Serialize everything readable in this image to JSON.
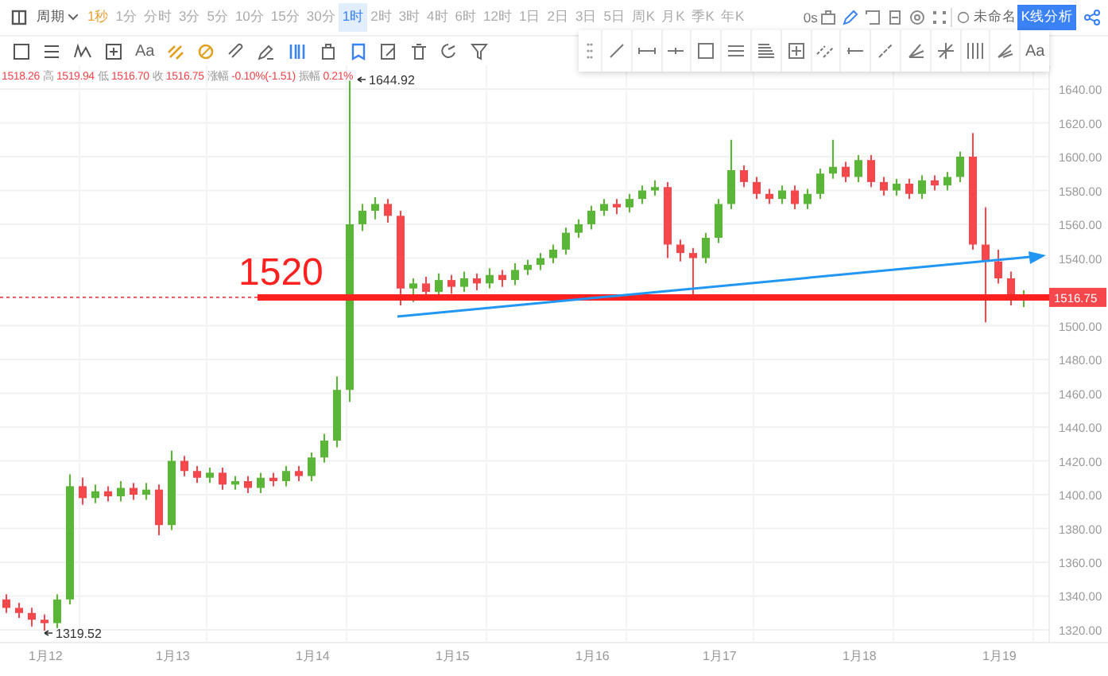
{
  "toolbar": {
    "period_label": "周期",
    "intervals": [
      {
        "label": "1秒",
        "selected": false,
        "accent": true
      },
      {
        "label": "1分",
        "selected": false,
        "accent": false
      },
      {
        "label": "分时",
        "selected": false,
        "accent": false
      },
      {
        "label": "3分",
        "selected": false,
        "accent": false
      },
      {
        "label": "5分",
        "selected": false,
        "accent": false
      },
      {
        "label": "10分",
        "selected": false,
        "accent": false
      },
      {
        "label": "15分",
        "selected": false,
        "accent": false
      },
      {
        "label": "30分",
        "selected": false,
        "accent": false
      },
      {
        "label": "1时",
        "selected": true,
        "accent": false
      },
      {
        "label": "2时",
        "selected": false,
        "accent": false
      },
      {
        "label": "3时",
        "selected": false,
        "accent": false
      },
      {
        "label": "4时",
        "selected": false,
        "accent": false
      },
      {
        "label": "6时",
        "selected": false,
        "accent": false
      },
      {
        "label": "12时",
        "selected": false,
        "accent": false
      },
      {
        "label": "1日",
        "selected": false,
        "accent": false
      },
      {
        "label": "2日",
        "selected": false,
        "accent": false
      },
      {
        "label": "3日",
        "selected": false,
        "accent": false
      },
      {
        "label": "5日",
        "selected": false,
        "accent": false
      },
      {
        "label": "周K",
        "selected": false,
        "accent": false
      },
      {
        "label": "月K",
        "selected": false,
        "accent": false
      },
      {
        "label": "季K",
        "selected": false,
        "accent": false
      },
      {
        "label": "年K",
        "selected": false,
        "accent": false
      }
    ],
    "refresh": "0s",
    "layout_name": "未命名",
    "analysis_button": "K线分析"
  },
  "drawing_tools": {
    "text_tool": "Aa"
  },
  "floating_toolbar": {
    "text_tool": "Aa"
  },
  "quote": {
    "first_value": "1518.26",
    "items": [
      {
        "label": "高",
        "value": "1519.94"
      },
      {
        "label": "低",
        "value": "1516.70"
      },
      {
        "label": "收",
        "value": "1516.75"
      },
      {
        "label": "涨幅",
        "value": "-0.10%(-1.51)"
      },
      {
        "label": "振幅",
        "value": "0.21%"
      }
    ]
  },
  "chart": {
    "high_marker": "1644.92",
    "last_price": "1516.75",
    "low_marker": "1319.52",
    "level_label": "1520",
    "chart_data": {
      "type": "candlestick",
      "categories": [
        null,
        null,
        null,
        "1月12",
        null,
        null,
        null,
        null,
        null,
        null,
        null,
        null,
        null,
        "1月13",
        null,
        null,
        null,
        null,
        null,
        null,
        null,
        null,
        null,
        null,
        "1月14",
        null,
        null,
        null,
        null,
        null,
        null,
        null,
        null,
        null,
        null,
        "1月15",
        null,
        null,
        null,
        null,
        null,
        null,
        null,
        null,
        null,
        null,
        "1月16",
        null,
        null,
        null,
        null,
        null,
        null,
        null,
        null,
        null,
        "1月17",
        null,
        null,
        null,
        null,
        null,
        null,
        null,
        null,
        null,
        null,
        "1月18",
        null,
        null,
        null,
        null,
        null,
        null,
        null,
        null,
        null,
        null,
        "1月19",
        null,
        null
      ],
      "ohlc": [
        [
          1338,
          1341,
          1330,
          1333
        ],
        [
          1333,
          1336,
          1327,
          1330
        ],
        [
          1330,
          1333,
          1322,
          1326
        ],
        [
          1326,
          1329,
          1319.52,
          1324
        ],
        [
          1324,
          1341,
          1321,
          1338
        ],
        [
          1338,
          1412,
          1335,
          1405
        ],
        [
          1405,
          1410,
          1394,
          1398
        ],
        [
          1398,
          1406,
          1395,
          1402
        ],
        [
          1402,
          1405,
          1396,
          1399
        ],
        [
          1399,
          1408,
          1396,
          1404
        ],
        [
          1404,
          1407,
          1397,
          1400
        ],
        [
          1400,
          1407,
          1397,
          1403
        ],
        [
          1403,
          1406,
          1376,
          1382
        ],
        [
          1382,
          1426,
          1379,
          1420
        ],
        [
          1420,
          1423,
          1411,
          1414
        ],
        [
          1414,
          1417,
          1407,
          1410
        ],
        [
          1410,
          1416,
          1407,
          1413
        ],
        [
          1413,
          1416,
          1403,
          1406
        ],
        [
          1406,
          1411,
          1403,
          1408
        ],
        [
          1408,
          1411,
          1401,
          1404
        ],
        [
          1404,
          1413,
          1401,
          1410
        ],
        [
          1410,
          1413,
          1405,
          1408
        ],
        [
          1408,
          1417,
          1405,
          1414
        ],
        [
          1414,
          1417,
          1408,
          1411
        ],
        [
          1411,
          1425,
          1408,
          1422
        ],
        [
          1422,
          1436,
          1419,
          1432
        ],
        [
          1432,
          1470,
          1428,
          1462
        ],
        [
          1462,
          1644.92,
          1455,
          1560
        ],
        [
          1560,
          1572,
          1556,
          1568
        ],
        [
          1568,
          1576,
          1563,
          1572
        ],
        [
          1572,
          1575,
          1561,
          1565
        ],
        [
          1565,
          1568,
          1512,
          1522
        ],
        [
          1522,
          1528,
          1514,
          1525
        ],
        [
          1525,
          1529,
          1516,
          1520
        ],
        [
          1520,
          1531,
          1517,
          1527
        ],
        [
          1527,
          1530,
          1519,
          1523
        ],
        [
          1523,
          1532,
          1520,
          1528
        ],
        [
          1528,
          1531,
          1521,
          1525
        ],
        [
          1525,
          1534,
          1522,
          1530
        ],
        [
          1530,
          1533,
          1523,
          1527
        ],
        [
          1527,
          1537,
          1524,
          1533
        ],
        [
          1533,
          1539,
          1530,
          1536
        ],
        [
          1536,
          1543,
          1533,
          1540
        ],
        [
          1540,
          1548,
          1537,
          1545
        ],
        [
          1545,
          1558,
          1542,
          1555
        ],
        [
          1555,
          1563,
          1552,
          1560
        ],
        [
          1560,
          1571,
          1557,
          1568
        ],
        [
          1568,
          1575,
          1565,
          1572
        ],
        [
          1572,
          1575,
          1566,
          1570
        ],
        [
          1570,
          1578,
          1567,
          1575
        ],
        [
          1575,
          1583,
          1572,
          1580
        ],
        [
          1580,
          1586,
          1577,
          1582
        ],
        [
          1582,
          1585,
          1540,
          1548
        ],
        [
          1548,
          1551,
          1538,
          1543
        ],
        [
          1543,
          1546,
          1518,
          1540
        ],
        [
          1540,
          1555,
          1537,
          1552
        ],
        [
          1552,
          1575,
          1549,
          1572
        ],
        [
          1572,
          1610,
          1569,
          1592
        ],
        [
          1592,
          1595,
          1582,
          1585
        ],
        [
          1585,
          1588,
          1575,
          1578
        ],
        [
          1578,
          1581,
          1572,
          1575
        ],
        [
          1575,
          1583,
          1572,
          1580
        ],
        [
          1580,
          1583,
          1569,
          1572
        ],
        [
          1572,
          1581,
          1569,
          1578
        ],
        [
          1578,
          1593,
          1575,
          1590
        ],
        [
          1590,
          1610,
          1587,
          1594
        ],
        [
          1594,
          1597,
          1585,
          1588
        ],
        [
          1588,
          1601,
          1585,
          1598
        ],
        [
          1598,
          1601,
          1582,
          1585
        ],
        [
          1585,
          1588,
          1577,
          1580
        ],
        [
          1580,
          1587,
          1577,
          1584
        ],
        [
          1584,
          1587,
          1575,
          1578
        ],
        [
          1578,
          1589,
          1575,
          1586
        ],
        [
          1586,
          1589,
          1580,
          1583
        ],
        [
          1583,
          1591,
          1580,
          1588
        ],
        [
          1588,
          1603,
          1585,
          1600
        ],
        [
          1600,
          1614,
          1545,
          1548
        ],
        [
          1548,
          1570,
          1502,
          1538
        ],
        [
          1538,
          1545,
          1525,
          1528
        ],
        [
          1528,
          1532,
          1512,
          1516
        ],
        [
          1516,
          1521,
          1511,
          1516.75
        ]
      ],
      "ylim": [
        1312.47,
        1654.12
      ],
      "grid": true,
      "yticks": [
        {
          "value": 1640,
          "label": "1640.00"
        },
        {
          "value": 1620,
          "label": "1620.00"
        },
        {
          "value": 1600,
          "label": "1600.00"
        },
        {
          "value": 1580,
          "label": "1580.00"
        },
        {
          "value": 1560,
          "label": "1560.00"
        },
        {
          "value": 1540,
          "label": "1540.00"
        },
        {
          "value": 1500,
          "label": "1500.00"
        },
        {
          "value": 1480,
          "label": "1480.00"
        },
        {
          "value": 1460,
          "label": "1460.00"
        },
        {
          "value": 1440,
          "label": "1440.00"
        },
        {
          "value": 1420,
          "label": "1420.00"
        },
        {
          "value": 1400,
          "label": "1400.00"
        },
        {
          "value": 1380,
          "label": "1380.00"
        },
        {
          "value": 1360,
          "label": "1360.00"
        },
        {
          "value": 1340,
          "label": "1340.00"
        },
        {
          "value": 1320,
          "label": "1320.00"
        }
      ]
    }
  }
}
